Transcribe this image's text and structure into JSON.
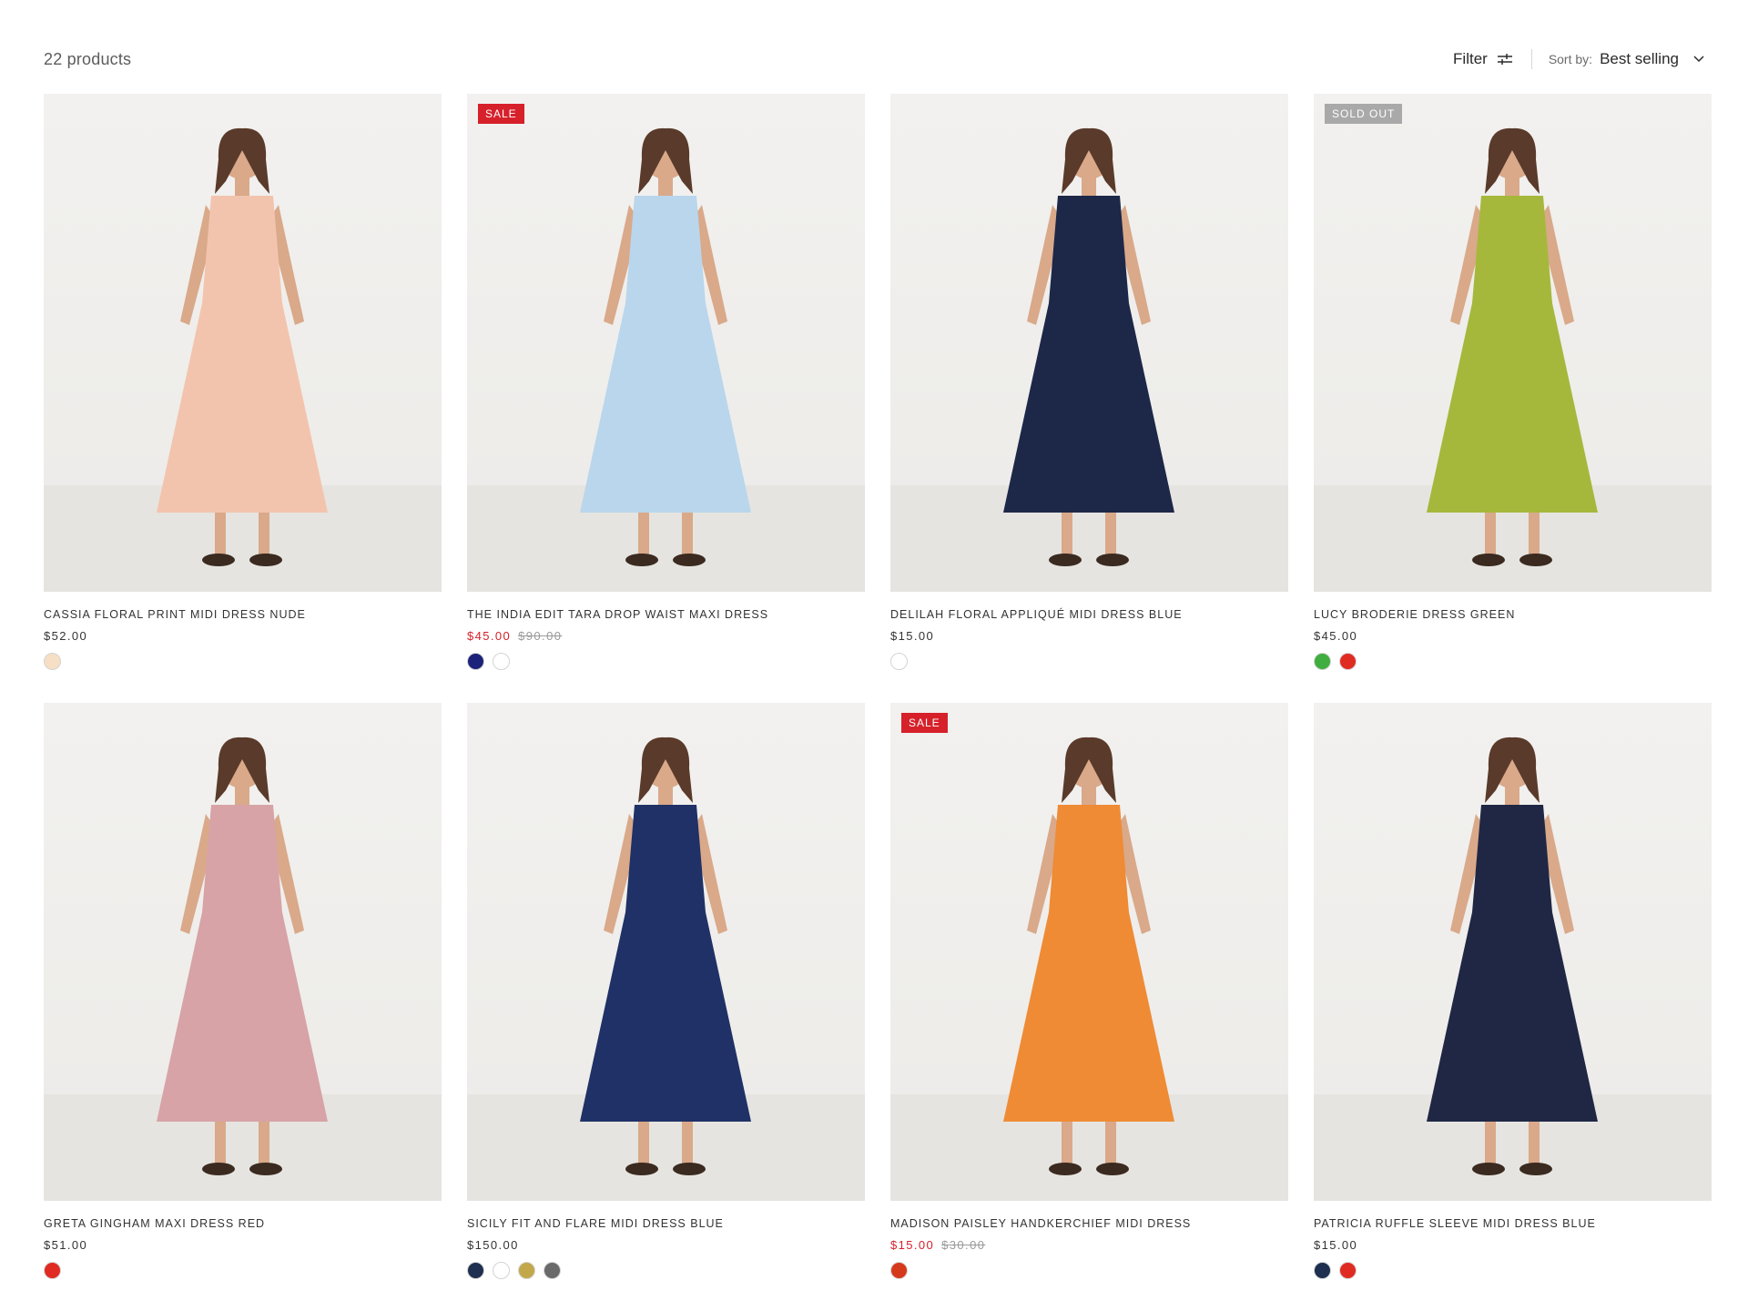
{
  "toolbar": {
    "count": "22 products",
    "filter_label": "Filter",
    "sort_label": "Sort by:",
    "sort_value": "Best selling"
  },
  "products": [
    {
      "title": "CASSIA FLORAL PRINT MIDI DRESS NUDE",
      "price": "$52.00",
      "compare_price": "",
      "badge": "",
      "on_sale": false,
      "dress_color": "#f3c4ad",
      "swatches": [
        "#f6dfc4"
      ]
    },
    {
      "title": "THE INDIA EDIT TARA DROP WAIST MAXI DRESS",
      "price": "$45.00",
      "compare_price": "$90.00",
      "badge": "SALE",
      "on_sale": true,
      "dress_color": "#b9d6ec",
      "swatches": [
        "#1c2279",
        "#ffffff"
      ]
    },
    {
      "title": "DELILAH FLORAL APPLIQUÉ MIDI DRESS BLUE",
      "price": "$15.00",
      "compare_price": "",
      "badge": "",
      "on_sale": false,
      "dress_color": "#1d2748",
      "swatches": [
        "#ffffff"
      ]
    },
    {
      "title": "LUCY BRODERIE DRESS GREEN",
      "price": "$45.00",
      "compare_price": "",
      "badge": "SOLD OUT",
      "on_sale": false,
      "dress_color": "#a5b83c",
      "swatches": [
        "#3fae3f",
        "#e02b23"
      ]
    },
    {
      "title": "GRETA GINGHAM MAXI DRESS RED",
      "price": "$51.00",
      "compare_price": "",
      "badge": "",
      "on_sale": false,
      "dress_color": "#d7a3a6",
      "swatches": [
        "#e02b23"
      ]
    },
    {
      "title": "SICILY FIT AND FLARE MIDI DRESS BLUE",
      "price": "$150.00",
      "compare_price": "",
      "badge": "",
      "on_sale": false,
      "dress_color": "#1f3166",
      "swatches": [
        "#1f2f4f",
        "#ffffff",
        "#c2a84a",
        "#6a6a6a"
      ]
    },
    {
      "title": "MADISON PAISLEY HANDKERCHIEF MIDI DRESS",
      "price": "$15.00",
      "compare_price": "$30.00",
      "badge": "SALE",
      "on_sale": true,
      "dress_color": "#ef8b35",
      "swatches": [
        "#d6381c"
      ]
    },
    {
      "title": "PATRICIA RUFFLE SLEEVE MIDI DRESS BLUE",
      "price": "$15.00",
      "compare_price": "",
      "badge": "",
      "on_sale": false,
      "dress_color": "#1f2744",
      "swatches": [
        "#1f2f4f",
        "#e02b23"
      ]
    }
  ]
}
